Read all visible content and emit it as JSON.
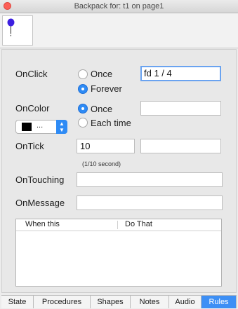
{
  "window": {
    "title": "Backpack for: t1 on page1"
  },
  "sprite": {
    "icon": "balloon-turtle-icon",
    "color": "#3c1fe0"
  },
  "onclick": {
    "label": "OnClick",
    "options": [
      "Once",
      "Forever"
    ],
    "selected": "Forever",
    "code": "fd 1 / 4"
  },
  "oncolor": {
    "label": "OnColor",
    "options": [
      "Once",
      "Each time"
    ],
    "selected": "Once",
    "color_value": "...",
    "swatch_color": "#000000",
    "code": ""
  },
  "ontick": {
    "label": "OnTick",
    "value": "10",
    "note": "(1/10 second)",
    "code": ""
  },
  "ontouching": {
    "label": "OnTouching",
    "code": ""
  },
  "onmessage": {
    "label": "OnMessage",
    "code": ""
  },
  "rules_table": {
    "columns": [
      "When this",
      "Do That"
    ],
    "rows": []
  },
  "tabs": {
    "items": [
      "State",
      "Procedures",
      "Shapes",
      "Notes",
      "Audio",
      "Rules"
    ],
    "active": "Rules"
  },
  "colors": {
    "accent": "#2e8bf5",
    "close": "#fc5f57"
  }
}
